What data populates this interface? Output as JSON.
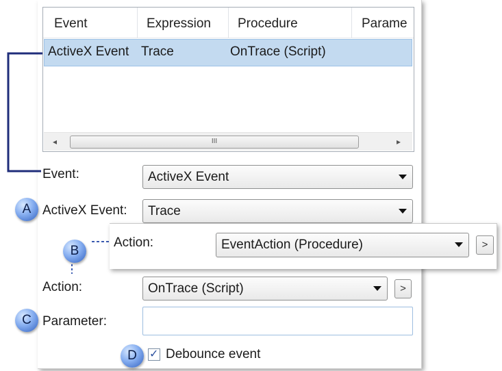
{
  "list": {
    "columns": [
      "Event",
      "Expression",
      "Procedure",
      "Parame"
    ],
    "rows": [
      {
        "event": "ActiveX Event",
        "expression": "Trace",
        "procedure": "OnTrace (Script)",
        "parameter": ""
      }
    ],
    "scroll_thumb_grip": "III",
    "scroll_left_icon": "◂",
    "scroll_right_icon": "▸"
  },
  "form": {
    "event_label": "Event:",
    "event_value": "ActiveX Event",
    "activex_label": "ActiveX Event:",
    "activex_value": "Trace",
    "action_label": "Action:",
    "action_value": "OnTrace (Script)",
    "action_more": ">",
    "parameter_label": "Parameter:",
    "parameter_value": "",
    "debounce_label": "Debounce event",
    "debounce_checked": true,
    "check_mark": "✓"
  },
  "popup": {
    "action_label": "Action:",
    "action_value": "EventAction (Procedure)",
    "action_more": ">"
  },
  "callouts": {
    "a": "A",
    "b": "B",
    "c": "C",
    "d": "D"
  },
  "colors": {
    "selection": "#c3daf0",
    "connector": "#1f2d7a",
    "badge": "#5b86d6"
  }
}
